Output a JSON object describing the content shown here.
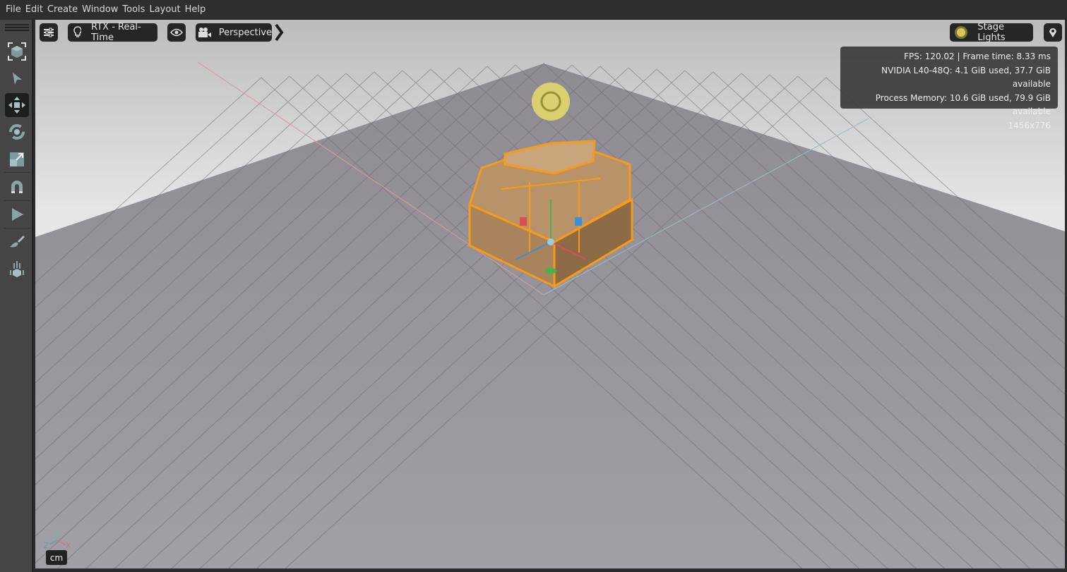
{
  "menu": [
    "File",
    "Edit",
    "Create",
    "Window",
    "Tools",
    "Layout",
    "Help"
  ],
  "toolbar": {
    "tools": [
      "frame-icon",
      "select-icon",
      "move-icon",
      "rotate-icon",
      "scale-icon",
      "snap-icon",
      "play-icon",
      "paint-icon",
      "physics-drop-icon"
    ],
    "active": "move-icon"
  },
  "viewport": {
    "render_mode": "RTX - Real-Time",
    "camera": "Perspective",
    "lights": "Stage Lights",
    "stats": {
      "fps_line": "FPS: 120.02 | Frame time: 8.33 ms",
      "gpu_line": "NVIDIA L40-48Q: 4.1 GiB used, 37.7 GiB available",
      "mem_line": "Process Memory: 10.6 GiB used, 79.9 GiB available",
      "resolution": "1456x776"
    },
    "unit": "cm",
    "axes": {
      "x": "X",
      "z": "Z"
    },
    "colors": {
      "selection": "#f59a1a",
      "light_icon": "#e8dc6a"
    }
  }
}
